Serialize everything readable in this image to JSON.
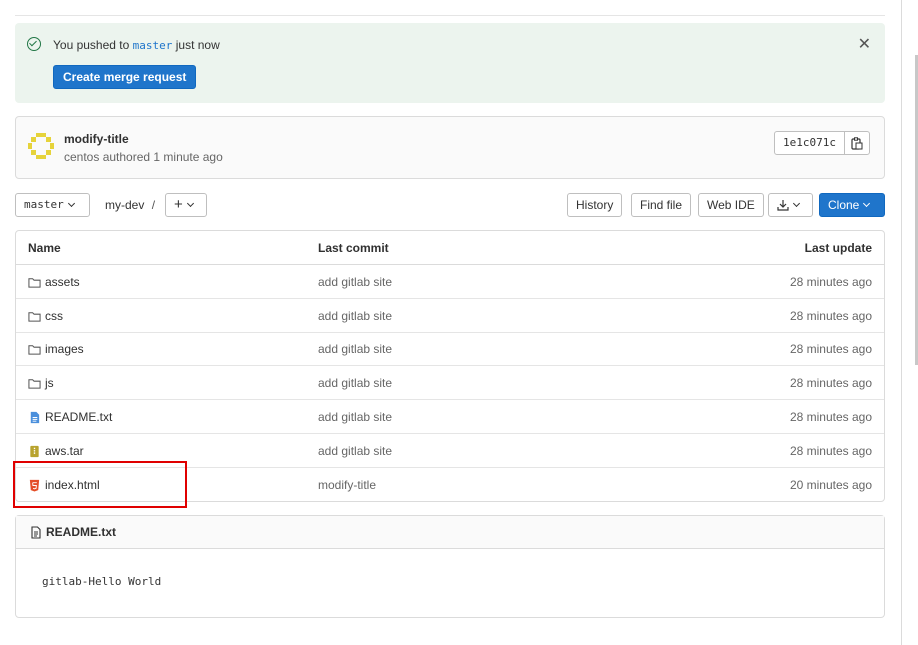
{
  "alert": {
    "message_before": "You pushed to",
    "branch": "master",
    "message_after": "just now",
    "action_label": "Create merge request"
  },
  "last_commit": {
    "title": "modify-title",
    "subtitle": "centos authored 1 minute ago",
    "sha": "1e1c071c"
  },
  "toolbar": {
    "branch": "master",
    "path": "my-dev",
    "path_sep": "/",
    "add_label": "+",
    "history": "History",
    "find_file": "Find file",
    "web_ide": "Web IDE",
    "clone": "Clone"
  },
  "table": {
    "headers": {
      "name": "Name",
      "last_commit": "Last commit",
      "last_update": "Last update"
    },
    "rows": [
      {
        "name": "assets",
        "type": "folder-icon",
        "commit": "add gitlab site",
        "updated": "28 minutes ago"
      },
      {
        "name": "css",
        "type": "folder-icon",
        "commit": "add gitlab site",
        "updated": "28 minutes ago"
      },
      {
        "name": "images",
        "type": "folder-icon",
        "commit": "add gitlab site",
        "updated": "28 minutes ago"
      },
      {
        "name": "js",
        "type": "folder-icon",
        "commit": "add gitlab site",
        "updated": "28 minutes ago"
      },
      {
        "name": "README.txt",
        "type": "text-file-icon",
        "commit": "add gitlab site",
        "updated": "28 minutes ago"
      },
      {
        "name": "aws.tar",
        "type": "archive-file-icon",
        "commit": "add gitlab site",
        "updated": "28 minutes ago"
      },
      {
        "name": "index.html",
        "type": "html-file-icon",
        "commit": "modify-title",
        "updated": "20 minutes ago"
      }
    ]
  },
  "readme": {
    "filename": "README.txt",
    "content": "gitlab-Hello World"
  },
  "colors": {
    "primary": "#1f75cb",
    "success": "#217645",
    "alert_bg": "#ecf4ee",
    "highlight": "#e00000"
  }
}
